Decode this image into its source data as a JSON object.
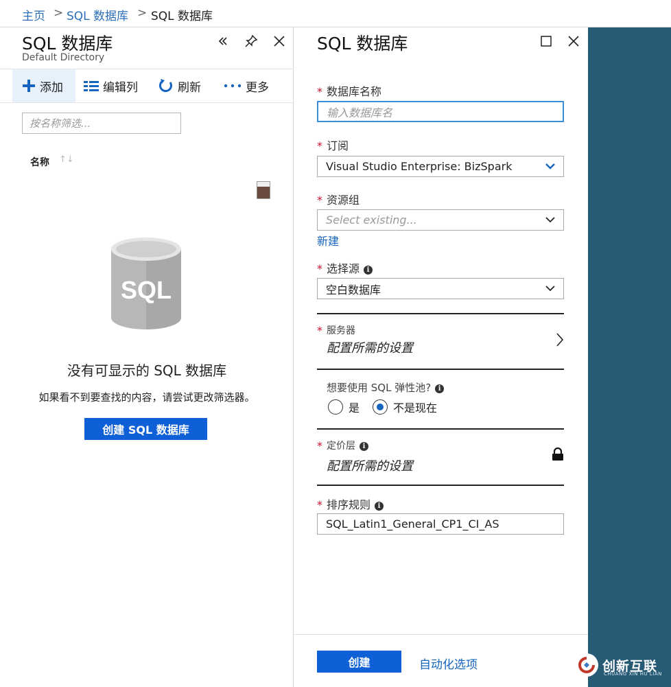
{
  "breadcrumb": {
    "items": [
      "主页",
      "SQL 数据库",
      "SQL 数据库"
    ]
  },
  "left_blade": {
    "title": "SQL 数据库",
    "subtitle": "Default Directory",
    "commands": [
      {
        "label": "添加",
        "icon": "plus-icon"
      },
      {
        "label": "编辑列",
        "icon": "columns-icon"
      },
      {
        "label": "刷新",
        "icon": "refresh-icon"
      },
      {
        "label": "更多",
        "icon": "more-icon"
      }
    ],
    "filter_placeholder": "按名称筛选...",
    "column_header": "名称",
    "empty_state": {
      "art_text": "SQL",
      "title": "没有可显示的 SQL 数据库",
      "description": "如果看不到要查找的内容，请尝试更改筛选器。",
      "button": "创建 SQL 数据库"
    }
  },
  "right_blade": {
    "title": "SQL 数据库",
    "fields": {
      "db_name": {
        "label": "数据库名称",
        "placeholder": "输入数据库名",
        "value": ""
      },
      "subscription": {
        "label": "订阅",
        "value": "Visual Studio Enterprise: BizSpark"
      },
      "resource_group": {
        "label": "资源组",
        "placeholder": "Select existing...",
        "new_link": "新建"
      },
      "source": {
        "label": "选择源",
        "value": "空白数据库"
      },
      "server": {
        "label": "服务器",
        "value": "配置所需的设置"
      },
      "elastic_pool": {
        "label": "想要使用 SQL 弹性池?",
        "options": [
          "是",
          "不是现在"
        ],
        "selected": "不是现在"
      },
      "pricing_tier": {
        "label": "定价层",
        "value": "配置所需的设置"
      },
      "collation": {
        "label": "排序规则",
        "value": "SQL_Latin1_General_CP1_CI_AS"
      }
    },
    "footer": {
      "create": "创建",
      "automation": "自动化选项"
    }
  },
  "watermark": {
    "text": "创新互联",
    "sub": "CHUANG XIN HU LIAN"
  },
  "colors": {
    "accent": "#0f5fd6",
    "link": "#2a6eb8",
    "required": "#c8102e",
    "side_panel": "#275a75"
  }
}
